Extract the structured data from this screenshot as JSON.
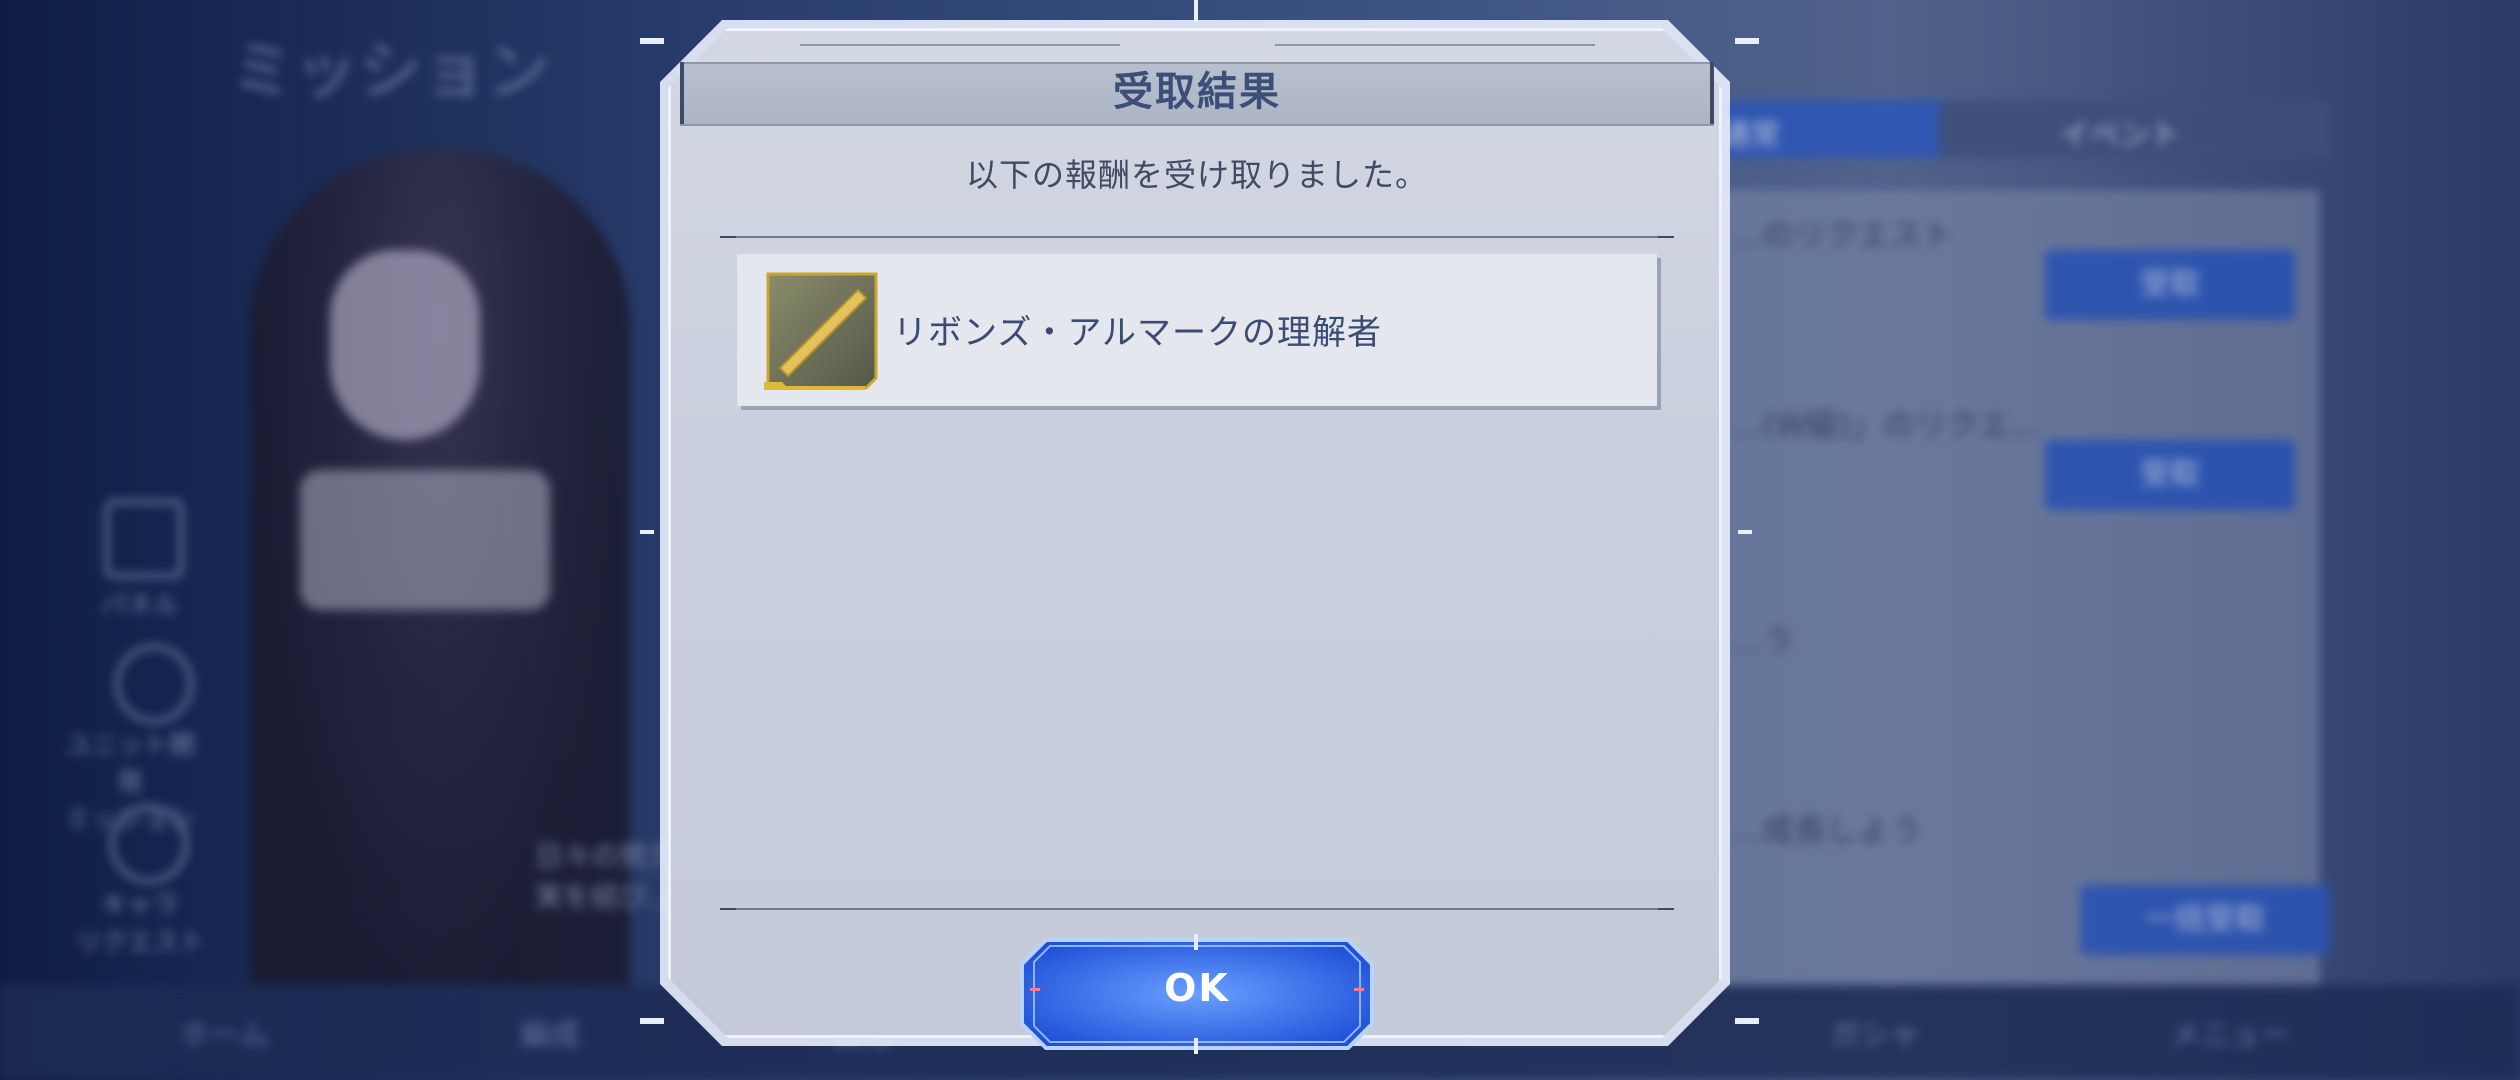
{
  "background": {
    "screen_title": "ミッション",
    "sidebar": [
      {
        "label": "パネル",
        "icon": "panel-icon"
      },
      {
        "label": "ユニット開発\nミッション",
        "icon": "unit-icon"
      },
      {
        "label": "キャラ\nリクエスト",
        "icon": "character-icon"
      }
    ],
    "tabs": [
      {
        "label": "通常"
      },
      {
        "label": "イベント"
      }
    ],
    "mission_rows": [
      {
        "text": "…のリクエスト",
        "button": "受取"
      },
      {
        "text": "…(W級)」のリクエ…",
        "button": "受取"
      },
      {
        "text": "…う",
        "button": ""
      },
      {
        "text": "…成長しよう",
        "button": "一括受取"
      }
    ],
    "mid_text": [
      "日々の努力…",
      "実を結び…"
    ],
    "bottom_bar": [
      "ホーム",
      "編成",
      "強化",
      "ガシャ",
      "メニュー"
    ]
  },
  "dialog": {
    "title": "受取結果",
    "message": "以下の報酬を受け取りました。",
    "rewards": [
      {
        "name": "リボンズ・アルマークの理解者",
        "icon": "title-plate-icon"
      }
    ],
    "ok_label": "OK"
  },
  "colors": {
    "accent_blue": "#2b55b8",
    "title_text": "#3c4f78",
    "reward_gold": "#c9a632"
  }
}
